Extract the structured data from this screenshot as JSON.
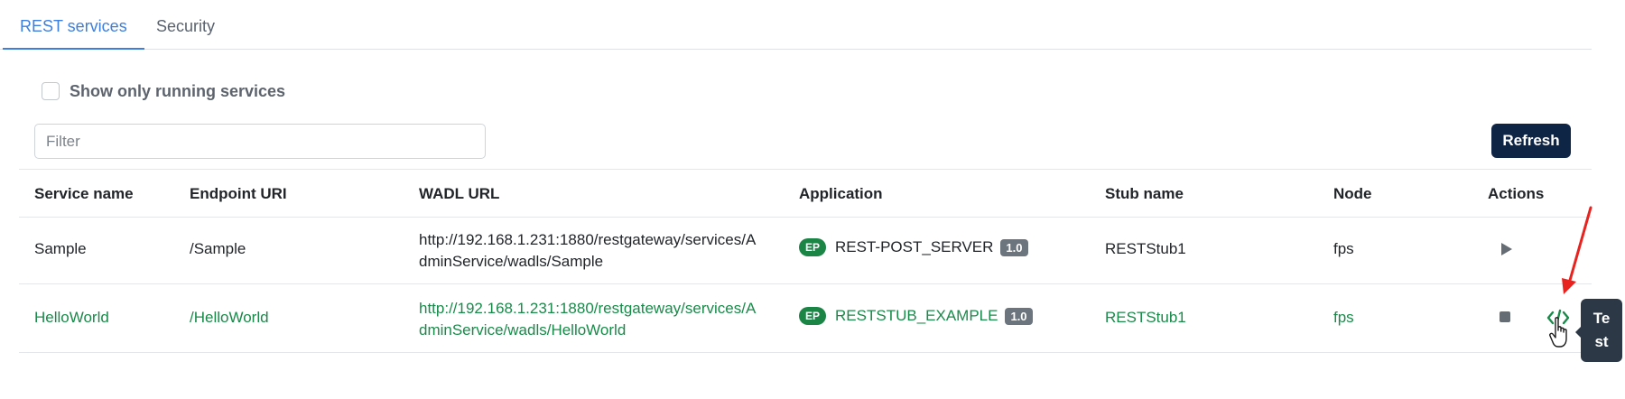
{
  "tabs": [
    {
      "label": "REST services",
      "active": true
    },
    {
      "label": "Security",
      "active": false
    }
  ],
  "filters": {
    "running_only_label": "Show only running services",
    "running_only_checked": false,
    "filter_placeholder": "Filter",
    "filter_value": ""
  },
  "toolbar": {
    "refresh_label": "Refresh"
  },
  "table": {
    "headers": [
      "Service name",
      "Endpoint URI",
      "WADL URL",
      "Application",
      "Stub name",
      "Node",
      "Actions"
    ],
    "rows": [
      {
        "service_name": "Sample",
        "endpoint_uri": "/Sample",
        "wadl_url_line1": "http://192.168.1.231:1880/restgateway/services/A",
        "wadl_url_line2": "dminService/wadls/Sample",
        "app_badge": "EP",
        "application": "REST-POST_SERVER",
        "version": "1.0",
        "stub_name": "RESTStub1",
        "node": "fps",
        "running": false,
        "actions": [
          "play-icon"
        ]
      },
      {
        "service_name": "HelloWorld",
        "endpoint_uri": "/HelloWorld",
        "wadl_url_line1": "http://192.168.1.231:1880/restgateway/services/A",
        "wadl_url_line2": "dminService/wadls/HelloWorld",
        "app_badge": "EP",
        "application": "RESTSTUB_EXAMPLE",
        "version": "1.0",
        "stub_name": "RESTStub1",
        "node": "fps",
        "running": true,
        "actions": [
          "stop-icon",
          "code-icon"
        ]
      }
    ]
  },
  "tooltip": {
    "line1": "Te",
    "line2": "st"
  },
  "colors": {
    "accent": "#3d7fe0",
    "running_text": "#1a8a4a",
    "refresh_button": "#0f2546",
    "ep_badge": "#1b8546",
    "version_badge": "#6c757d",
    "tooltip_bg": "#2c3846",
    "annotation_arrow": "#e8231f"
  }
}
